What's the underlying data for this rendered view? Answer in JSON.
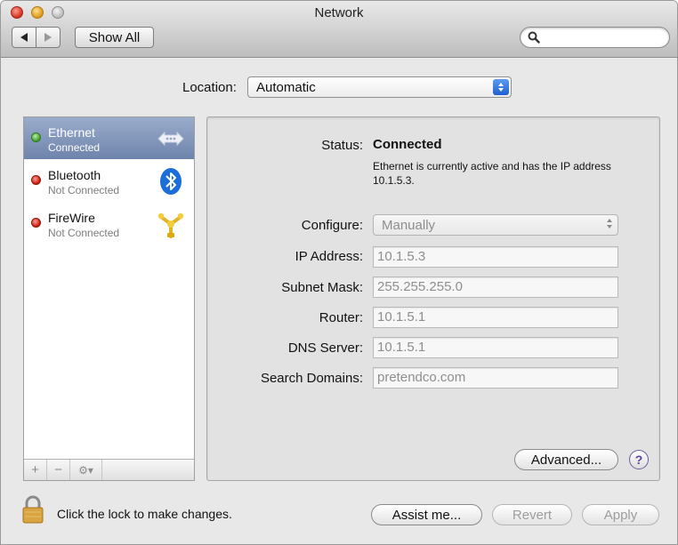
{
  "window": {
    "title": "Network"
  },
  "toolbar": {
    "show_all_label": "Show All",
    "search": {
      "value": "",
      "placeholder": ""
    }
  },
  "location": {
    "label": "Location:",
    "value": "Automatic"
  },
  "services": [
    {
      "name": "Ethernet",
      "status": "Connected",
      "status_color": "#3f9b2b",
      "icon": "ethernet-icon",
      "selected": true
    },
    {
      "name": "Bluetooth",
      "status": "Not Connected",
      "status_color": "#c9180c",
      "icon": "bluetooth-icon",
      "selected": false
    },
    {
      "name": "FireWire",
      "status": "Not Connected",
      "status_color": "#c9180c",
      "icon": "firewire-icon",
      "selected": false
    }
  ],
  "sidebar_bar": {
    "add": "+",
    "remove": "−",
    "action": "⚙▾"
  },
  "detail": {
    "status_label": "Status:",
    "status_value": "Connected",
    "status_description": "Ethernet is currently active and has the IP address 10.1.5.3.",
    "configure_label": "Configure:",
    "configure_value": "Manually",
    "ip_label": "IP Address:",
    "ip_value": "10.1.5.3",
    "subnet_label": "Subnet Mask:",
    "subnet_value": "255.255.255.0",
    "router_label": "Router:",
    "router_value": "10.1.5.1",
    "dns_label": "DNS Server:",
    "dns_value": "10.1.5.1",
    "search_domains_label": "Search Domains:",
    "search_domains_value": "pretendco.com",
    "advanced_label": "Advanced...",
    "help_label": "?"
  },
  "footer": {
    "lock_text": "Click the lock to make changes.",
    "assist_label": "Assist me...",
    "revert_label": "Revert",
    "apply_label": "Apply"
  }
}
